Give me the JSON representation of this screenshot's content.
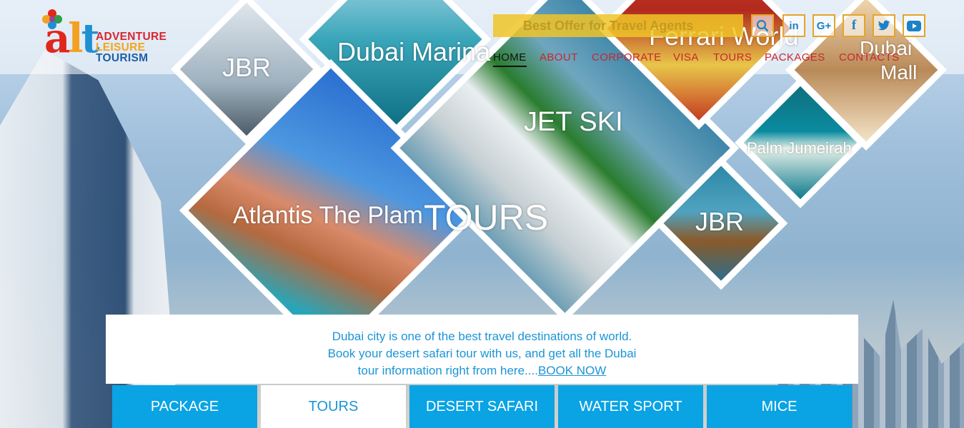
{
  "logo": {
    "mark": "alt",
    "line1": "ADVENTURE",
    "line2": "LEISURE",
    "line3": "TOURISM"
  },
  "offer": {
    "text": "Best Offer for Travel Agents"
  },
  "social": [
    {
      "icon": "search-icon",
      "glyph": "⚲"
    },
    {
      "icon": "linkedin-icon",
      "glyph": "in"
    },
    {
      "icon": "google-plus-icon",
      "glyph": "G+"
    },
    {
      "icon": "facebook-icon",
      "glyph": "f"
    },
    {
      "icon": "twitter-icon",
      "glyph": "t"
    },
    {
      "icon": "youtube-icon",
      "glyph": "▶"
    }
  ],
  "nav": {
    "items": [
      "HOME",
      "ABOUT",
      "CORPORATE",
      "VISA",
      "TOURS",
      "PACKAGES",
      "CONTACTS"
    ],
    "active": "HOME"
  },
  "hero": {
    "labels": [
      "JBR",
      "Dubai Marina",
      "Ferrari World",
      "Dubai",
      "Mall",
      "JET SKI",
      "Palm Jumeirah",
      "Atlantis The Plam",
      "TOURS",
      "JBR"
    ]
  },
  "intro": {
    "line1": "Dubai city is one of the best travel destinations of",
    "line2": "world. Book your desert safari tour with us, and get all",
    "line3": "the Dubai tour information right from here....",
    "link": "BOOK NOW"
  },
  "tabs": [
    "PACKAGE",
    "TOURS",
    "DESERT SAFARI",
    "WATER SPORT",
    "MICE"
  ],
  "colors": {
    "accent": "#0aa3e4",
    "nav": "#c9262e",
    "offer": "#f0c428",
    "link": "#1b95d6"
  }
}
